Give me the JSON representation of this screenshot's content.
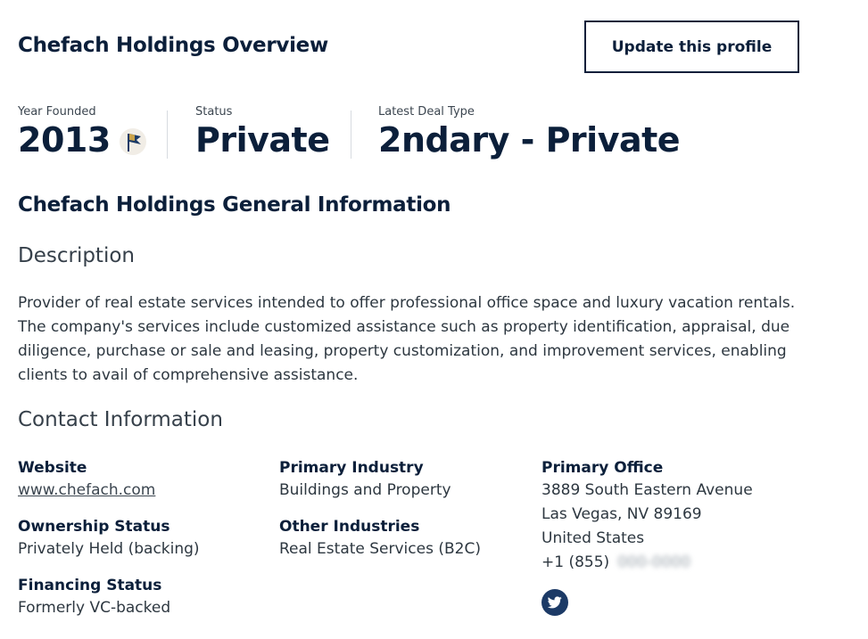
{
  "header": {
    "title": "Chefach Holdings Overview",
    "update_button": "Update this profile"
  },
  "stats": [
    {
      "label": "Year Founded",
      "value": "2013",
      "icon": "flag-icon"
    },
    {
      "label": "Status",
      "value": "Private"
    },
    {
      "label": "Latest Deal Type",
      "value": "2ndary - Private"
    }
  ],
  "general": {
    "heading": "Chefach Holdings General Information",
    "description_heading": "Description",
    "description": "Provider of real estate services intended to offer professional office space and luxury vacation rentals. The company's services include customized assistance such as property identification, appraisal, due diligence, purchase or sale and leasing, property customization, and improvement services, enabling clients to avail of comprehensive assistance."
  },
  "contact": {
    "heading": "Contact Information",
    "website_label": "Website",
    "website": "www.chefach.com",
    "ownership_label": "Ownership Status",
    "ownership": "Privately Held (backing)",
    "financing_label": "Financing Status",
    "financing": "Formerly VC-backed",
    "primary_industry_label": "Primary Industry",
    "primary_industry": "Buildings and Property",
    "other_industries_label": "Other Industries",
    "other_industries": "Real Estate Services (B2C)",
    "office_label": "Primary Office",
    "address_line1": "3889 South Eastern Avenue",
    "address_line2": "Las Vegas, NV 89169",
    "country": "United States",
    "phone_prefix": "+1 (855)",
    "phone_hidden": "000-0000",
    "social_icon": "twitter-icon"
  },
  "colors": {
    "navy": "#0b1f3a",
    "text": "#2d3740",
    "divider": "#d7dbe0",
    "twitter_bg": "#1c3a66"
  }
}
